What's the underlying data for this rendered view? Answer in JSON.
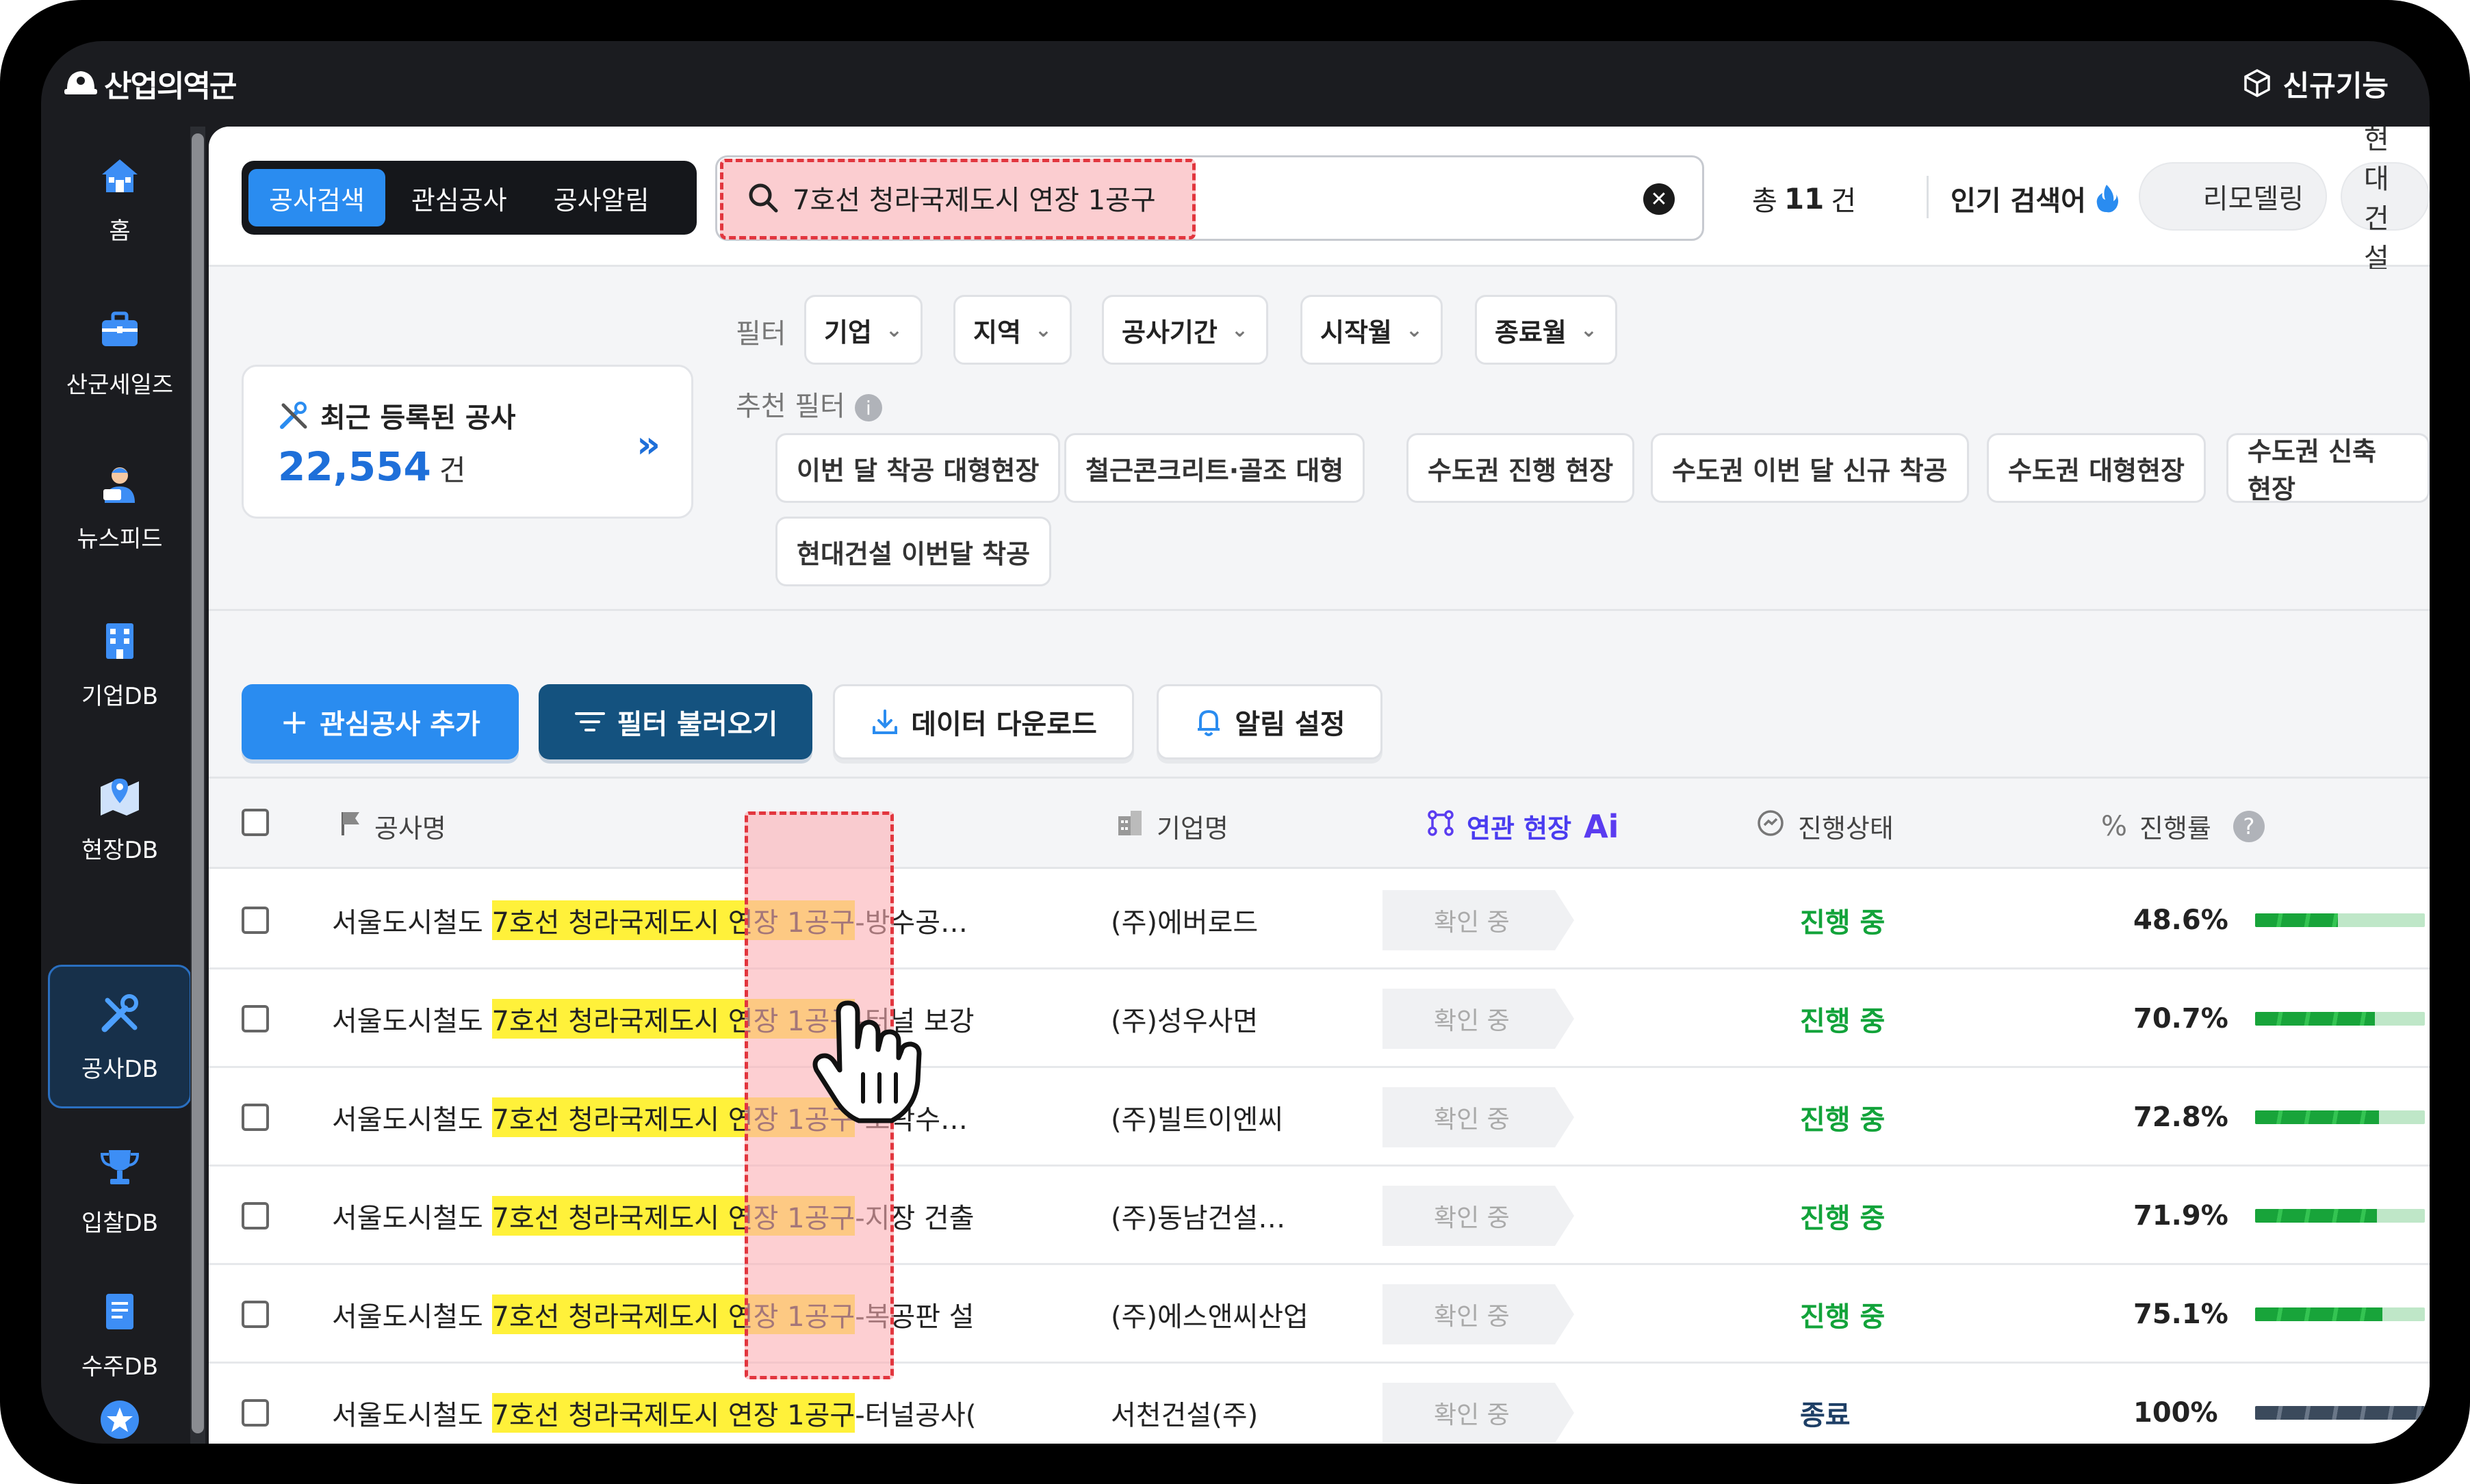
{
  "brand": {
    "name": "산업의역군"
  },
  "topbar": {
    "new_features": "신규기능"
  },
  "sidebar": {
    "items": [
      {
        "label": "홈",
        "icon": "home-icon"
      },
      {
        "label": "산군세일즈",
        "icon": "briefcase-icon"
      },
      {
        "label": "뉴스피드",
        "icon": "news-reporter-icon"
      },
      {
        "label": "기업DB",
        "icon": "building-icon"
      },
      {
        "label": "현장DB",
        "icon": "map-pin-icon"
      },
      {
        "label": "공사DB",
        "icon": "tools-icon",
        "active": true
      },
      {
        "label": "입찰DB",
        "icon": "trophy-icon"
      },
      {
        "label": "수주DB",
        "icon": "document-icon"
      }
    ]
  },
  "search": {
    "tabs": [
      {
        "label": "공사검색",
        "active": true
      },
      {
        "label": "관심공사"
      },
      {
        "label": "공사알림"
      }
    ],
    "value": "7호선 청라국제도시 연장 1공구",
    "total_prefix": "총",
    "total_count": "11",
    "total_unit": "건",
    "popular_label": "인기 검색어",
    "popular_terms": [
      "리모델링",
      "현대건설"
    ]
  },
  "recent": {
    "title": "최근 등록된 공사",
    "count": "22,554",
    "unit": "건"
  },
  "filters": {
    "label": "필터",
    "buttons": [
      "기업",
      "지역",
      "공사기간",
      "시작월",
      "종료월"
    ],
    "recommend_label": "추천 필터",
    "recommended": [
      "이번 달 착공 대형현장",
      "철근콘크리트·골조 대형",
      "수도권 진행 현장",
      "수도권 이번 달 신규 착공",
      "수도권 대형현장",
      "수도권 신축 현장",
      "현대건설 이번달 착공"
    ]
  },
  "actions": {
    "add": "관심공사 추가",
    "load_filter": "필터 불러오기",
    "download": "데이터 다운로드",
    "alert": "알림 설정"
  },
  "table": {
    "headers": {
      "name": "공사명",
      "company": "기업명",
      "related": "연관 현장",
      "ai": "Ai",
      "status": "진행상태",
      "progress": "진행률"
    },
    "rows": [
      {
        "prefix": "서울도시철도 ",
        "match": "7호선 청라국제도시 연장 1공구",
        "suffix": "-방수공…",
        "company": "(주)에버로드",
        "related": "확인 중",
        "status": "진행 중",
        "progress": "48.6%",
        "progress_value": 48.6
      },
      {
        "prefix": "서울도시철도 ",
        "match": "7호선 청라국제도시 연장 1공구",
        "suffix": "-터널 보강",
        "company": "(주)성우사면",
        "related": "확인 중",
        "status": "진행 중",
        "progress": "70.7%",
        "progress_value": 70.7
      },
      {
        "prefix": "서울도시철도 ",
        "match": "7호선 청라국제도시 연장 1공구",
        "suffix": "-오탁수…",
        "company": "(주)빌트이엔씨",
        "related": "확인 중",
        "status": "진행 중",
        "progress": "72.8%",
        "progress_value": 72.8
      },
      {
        "prefix": "서울도시철도 ",
        "match": "7호선 청라국제도시 연장 1공구",
        "suffix": "-지장 건출",
        "company": "(주)동남건설…",
        "related": "확인 중",
        "status": "진행 중",
        "progress": "71.9%",
        "progress_value": 71.9
      },
      {
        "prefix": "서울도시철도 ",
        "match": "7호선 청라국제도시 연장 1공구",
        "suffix": "-복공판 설",
        "company": "(주)에스앤씨산업",
        "related": "확인 중",
        "status": "진행 중",
        "progress": "75.1%",
        "progress_value": 75.1
      },
      {
        "prefix": "서울도시철도 ",
        "match": "7호선 청라국제도시 연장 1공구",
        "suffix": "-터널공사(",
        "company": "서천건설(주)",
        "related": "확인 중",
        "status": "종료",
        "progress": "100%",
        "progress_value": 100
      }
    ]
  },
  "colors": {
    "accent": "#2a8cf0",
    "navy": "#14527f",
    "progress": "#18a43a",
    "status_active": "#12a33a",
    "status_done": "#1e3f66",
    "highlight": "#fff13a",
    "annotation": "#e2363e",
    "ai": "#6a3cf0"
  }
}
